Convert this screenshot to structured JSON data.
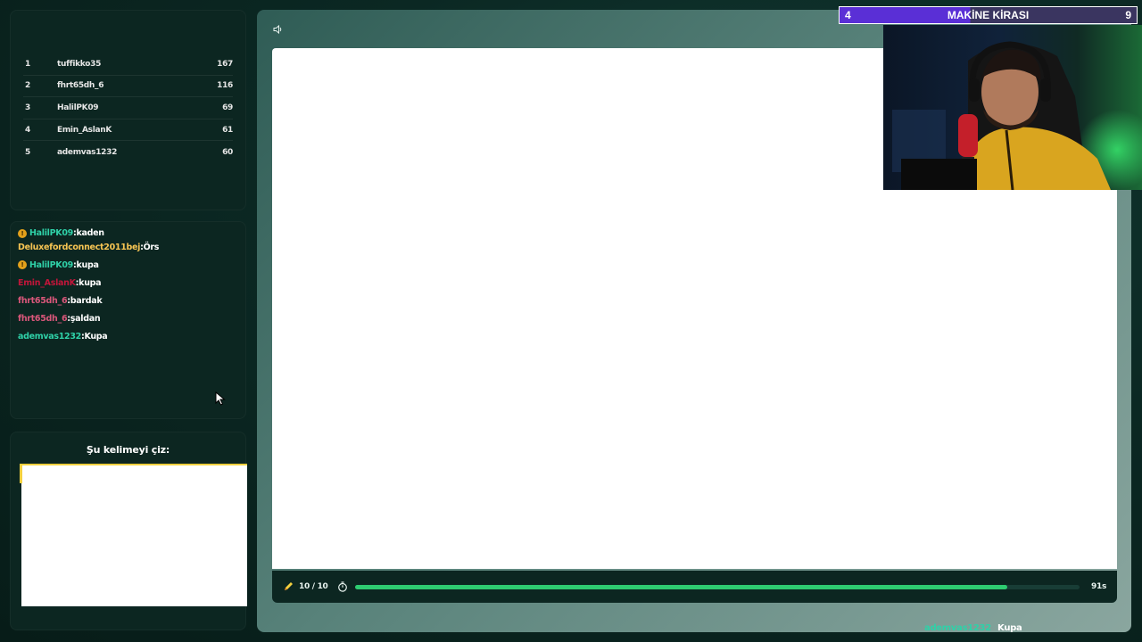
{
  "leaderboard": {
    "rows": [
      {
        "rank": "1",
        "name": "tuffikko35",
        "score": "167",
        "color": "#e6e6e6"
      },
      {
        "rank": "2",
        "name": "fhrt65dh_6",
        "score": "116",
        "color": "#e6e6e6"
      },
      {
        "rank": "3",
        "name": "HalilPK09",
        "score": "69",
        "color": "#e6e6e6"
      },
      {
        "rank": "4",
        "name": "Emin_AslanK",
        "score": "61",
        "color": "#e6e6e6"
      },
      {
        "rank": "5",
        "name": "ademvas1232",
        "score": "60",
        "color": "#e6e6e6"
      }
    ]
  },
  "chat": {
    "messages": [
      {
        "user": "HalilPK09",
        "text": "kaden",
        "color": "#2fd1a8",
        "badge": true
      },
      {
        "user": "Deluxefordconnect2011bej",
        "text": "Örs",
        "color": "#f6c453",
        "badge": false
      },
      {
        "user": "HalilPK09",
        "text": "kupa",
        "color": "#2fd1a8",
        "badge": true
      },
      {
        "user": "Emin_AslanK",
        "text": "kupa",
        "color": "#c0163a",
        "badge": false
      },
      {
        "user": "fhrt65dh_6",
        "text": "bardak",
        "color": "#d9577a",
        "badge": false
      },
      {
        "user": "fhrt65dh_6",
        "text": "şaldan",
        "color": "#d9577a",
        "badge": false
      },
      {
        "user": "ademvas1232",
        "text": "Kupa",
        "color": "#2fd1a8",
        "badge": false
      }
    ],
    "badge_glyph": "!"
  },
  "word_panel": {
    "title": "Şu kelimeyi çiz:"
  },
  "stage": {
    "round": "10 / 10",
    "time_left": "91s",
    "progress": 0.9
  },
  "last_guess": {
    "user": "ademvas1232",
    "text": "Kupa",
    "user_color": "#2fd1a8"
  },
  "overlay": {
    "left": "4",
    "title": "MAKİNE KİRASI",
    "right": "9"
  },
  "colors": {
    "accent_green": "#2ecc71",
    "highlight_yellow": "#f4d03f",
    "overlay_purple": "#5a2fd6"
  }
}
